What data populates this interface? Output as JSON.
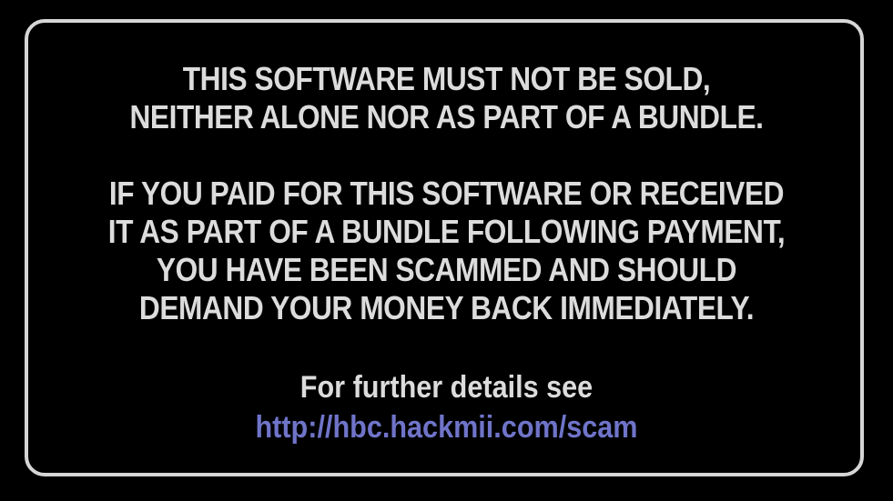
{
  "notice": {
    "block1": [
      "THIS SOFTWARE MUST NOT BE SOLD,",
      "NEITHER ALONE NOR AS PART OF A BUNDLE."
    ],
    "block2": [
      "IF YOU PAID FOR THIS SOFTWARE OR RECEIVED",
      "IT AS PART OF A BUNDLE FOLLOWING PAYMENT,",
      "YOU HAVE BEEN SCAMMED AND SHOULD",
      "DEMAND YOUR MONEY BACK IMMEDIATELY."
    ],
    "details_text": "For further details see",
    "details_link": "http://hbc.hackmii.com/scam"
  },
  "colors": {
    "background": "#000000",
    "frame": "#d6d6d6",
    "text": "#dcdcdc",
    "link": "#6f74c9"
  }
}
